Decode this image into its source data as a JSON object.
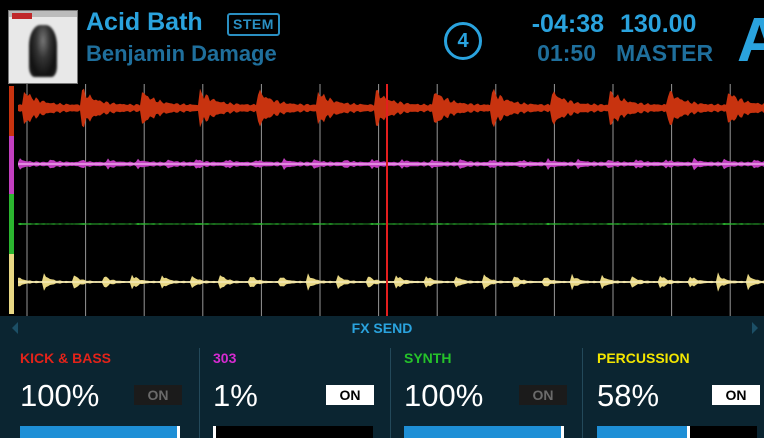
{
  "track": {
    "title": "Acid Bath",
    "stem_badge": "STEM",
    "artist": "Benjamin Damage"
  },
  "deck": {
    "number": "4",
    "letter": "A",
    "time_remaining": "-04:38",
    "time_elapsed": "01:50",
    "bpm": "130.00",
    "sync_mode": "MASTER"
  },
  "fx_send": {
    "label": "FX SEND"
  },
  "stems": [
    {
      "name": "KICK & BASS",
      "color": "#e2231a",
      "value": "100%",
      "button": "ON",
      "button_active": false,
      "level": 1.0
    },
    {
      "name": "303",
      "color": "#d52bd0",
      "value": "1%",
      "button": "ON",
      "button_active": true,
      "level": 0.01
    },
    {
      "name": "SYNTH",
      "color": "#25c22a",
      "value": "100%",
      "button": "ON",
      "button_active": false,
      "level": 1.0
    },
    {
      "name": "PERCUSSION",
      "color": "#f3e600",
      "value": "58%",
      "button": "ON",
      "button_active": true,
      "level": 0.58
    }
  ],
  "waveform_colors": {
    "kick_bass": "#c8330f",
    "303": "#c23fc0",
    "synth": "#2bb52f",
    "percussion": "#e8d784",
    "playhead": "#e41e1e",
    "beatgrid": "#c9c9c9"
  }
}
